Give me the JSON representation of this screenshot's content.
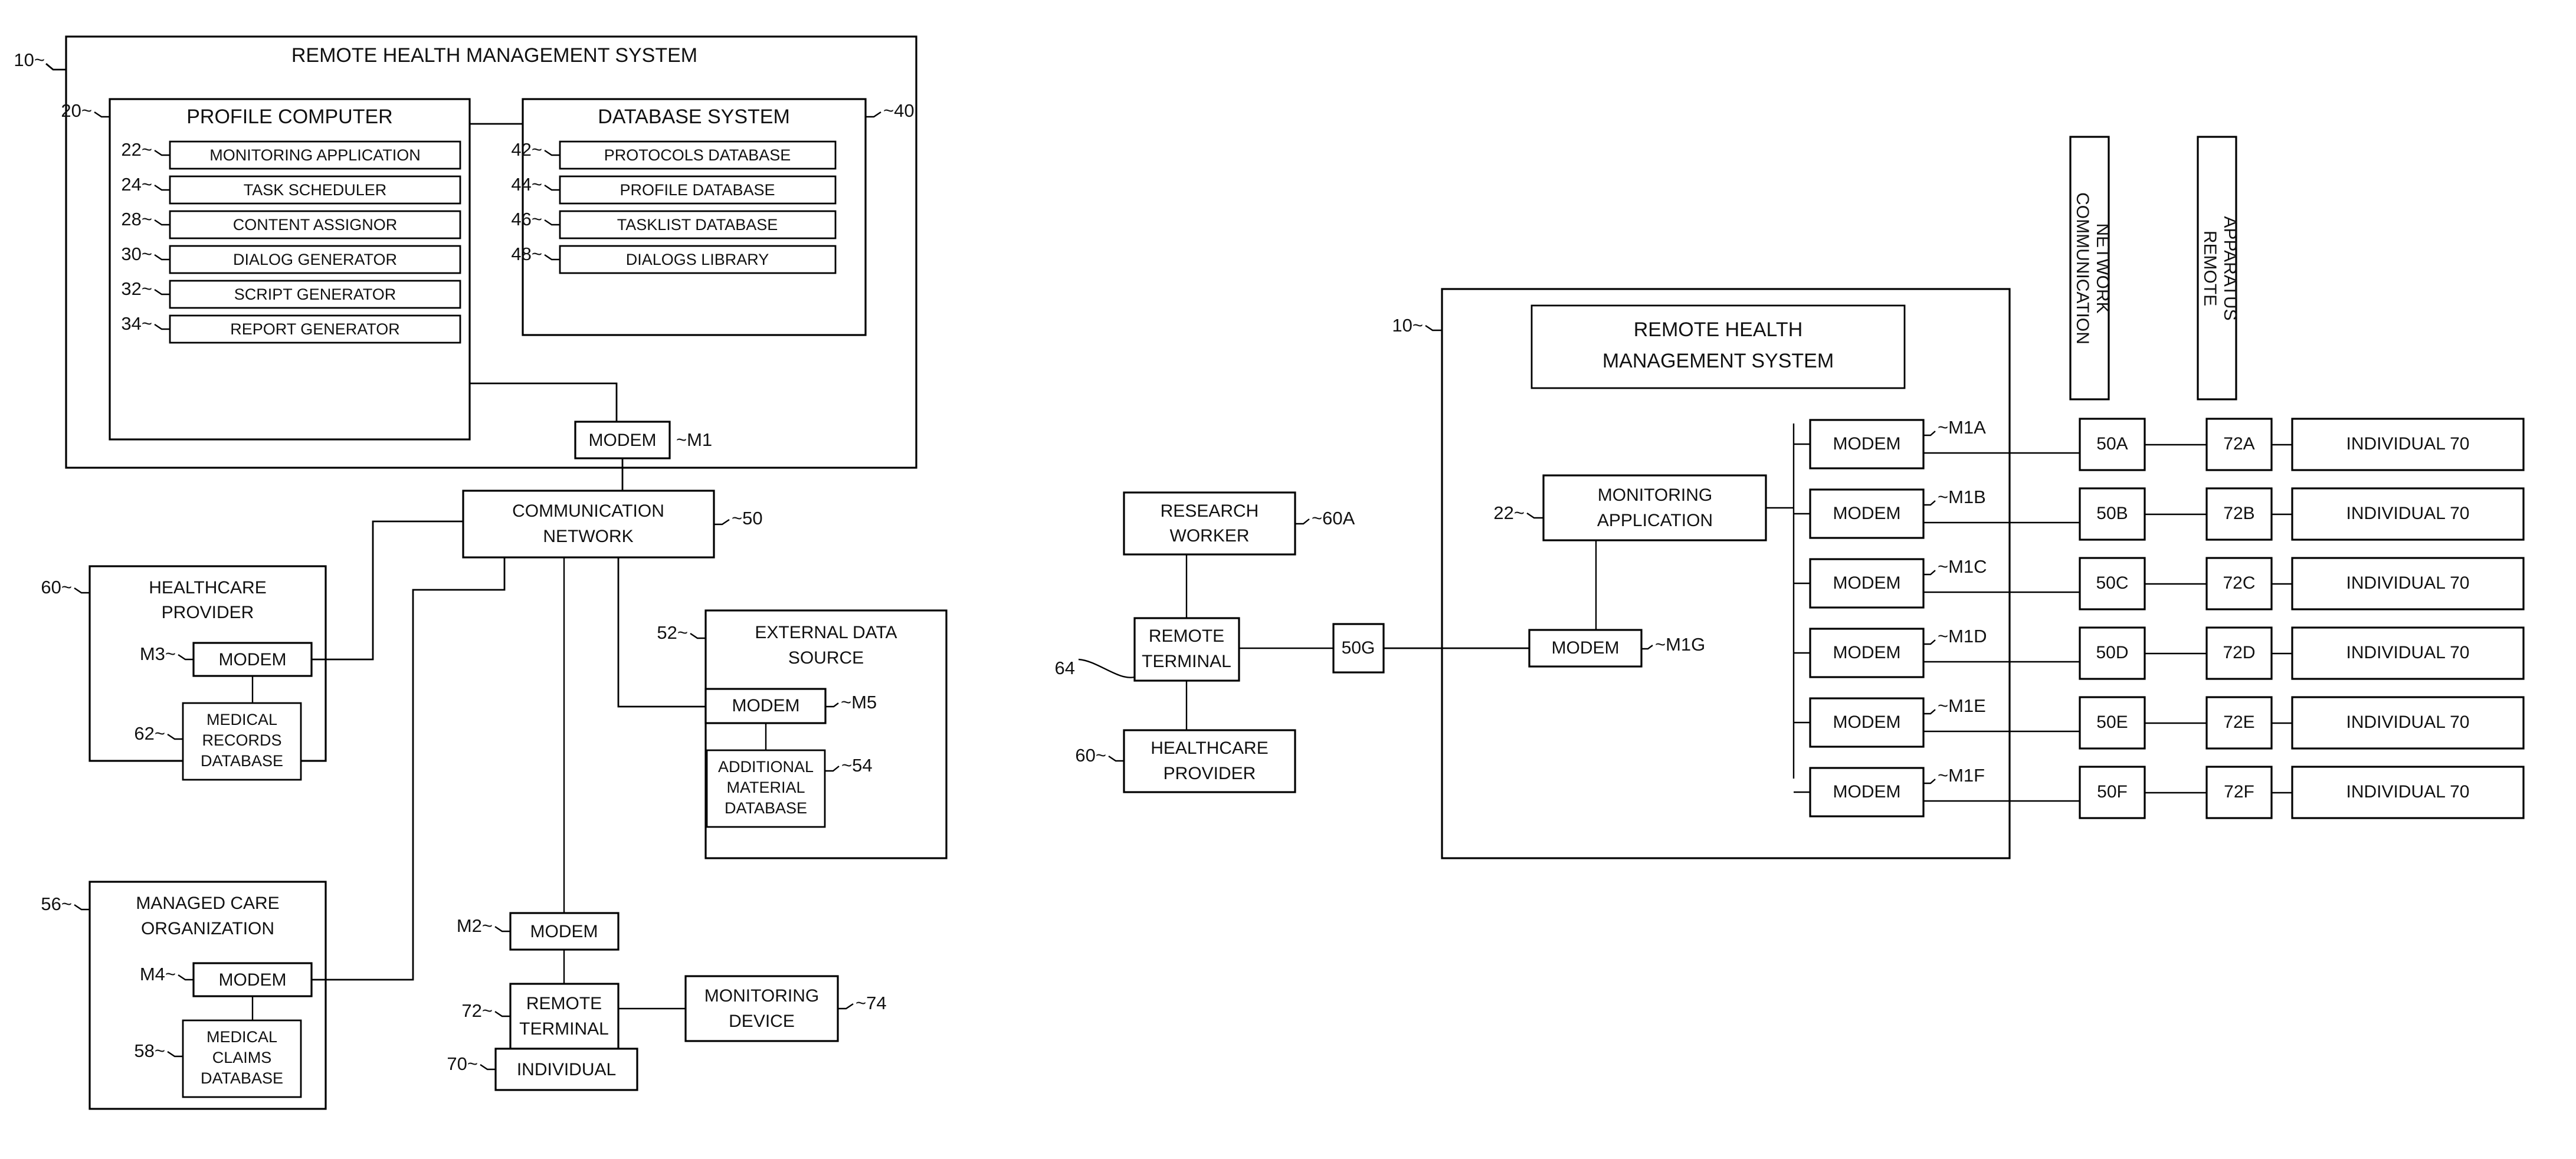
{
  "figure1": {
    "system": {
      "ref": "10~",
      "title": "REMOTE HEALTH MANAGEMENT SYSTEM"
    },
    "profile_computer": {
      "ref": "20~",
      "title": "PROFILE COMPUTER",
      "items": [
        {
          "ref": "22~",
          "label": "MONITORING APPLICATION"
        },
        {
          "ref": "24~",
          "label": "TASK SCHEDULER"
        },
        {
          "ref": "28~",
          "label": "CONTENT ASSIGNOR"
        },
        {
          "ref": "30~",
          "label": "DIALOG GENERATOR"
        },
        {
          "ref": "32~",
          "label": "SCRIPT GENERATOR"
        },
        {
          "ref": "34~",
          "label": "REPORT GENERATOR"
        }
      ]
    },
    "database_system": {
      "ref": "~40",
      "title": "DATABASE SYSTEM",
      "items": [
        {
          "ref": "42~",
          "label": "PROTOCOLS DATABASE"
        },
        {
          "ref": "44~",
          "label": "PROFILE DATABASE"
        },
        {
          "ref": "46~",
          "label": "TASKLIST DATABASE"
        },
        {
          "ref": "48~",
          "label": "DIALOGS LIBRARY"
        }
      ]
    },
    "modem_m1": {
      "label": "MODEM",
      "ref": "~M1"
    },
    "communication_network": {
      "ref": "~50",
      "line1": "COMMUNICATION",
      "line2": "NETWORK"
    },
    "healthcare_provider": {
      "ref": "60~",
      "line1": "HEALTHCARE",
      "line2": "PROVIDER",
      "modem": {
        "ref": "M3~",
        "label": "MODEM"
      },
      "database": {
        "ref": "62~",
        "line1": "MEDICAL",
        "line2": "RECORDS",
        "line3": "DATABASE"
      }
    },
    "external_data_source": {
      "ref": "52~",
      "line1": "EXTERNAL DATA",
      "line2": "SOURCE",
      "modem": {
        "label": "MODEM",
        "ref": "~M5"
      },
      "database": {
        "ref": "~54",
        "line1": "ADDITIONAL",
        "line2": "MATERIAL",
        "line3": "DATABASE"
      }
    },
    "managed_care_organization": {
      "ref": "56~",
      "line1": "MANAGED CARE",
      "line2": "ORGANIZATION",
      "modem": {
        "ref": "M4~",
        "label": "MODEM"
      },
      "database": {
        "ref": "58~",
        "line1": "MEDICAL",
        "line2": "CLAIMS",
        "line3": "DATABASE"
      }
    },
    "modem_m2": {
      "ref": "M2~",
      "label": "MODEM"
    },
    "remote_terminal": {
      "ref": "72~",
      "line1": "REMOTE",
      "line2": "TERMINAL"
    },
    "individual": {
      "ref": "70~",
      "label": "INDIVIDUAL"
    },
    "monitoring_device": {
      "ref": "~74",
      "line1": "MONITORING",
      "line2": "DEVICE"
    }
  },
  "figure2": {
    "column_headers": [
      {
        "line1": "COMMUNICATION",
        "line2": "NETWORK"
      },
      {
        "line1": "REMOTE",
        "line2": "APPARATUS"
      }
    ],
    "system": {
      "ref": "10~",
      "line1": "REMOTE HEALTH",
      "line2": "MANAGEMENT SYSTEM"
    },
    "monitoring_application": {
      "ref": "22~",
      "line1": "MONITORING",
      "line2": "APPLICATION"
    },
    "modem_m1g": {
      "label": "MODEM",
      "ref": "~M1G"
    },
    "gateway_50g": {
      "label": "50G"
    },
    "research_worker": {
      "ref": "~60A",
      "line1": "RESEARCH",
      "line2": "WORKER"
    },
    "remote_terminal": {
      "ref": "64",
      "line1": "REMOTE",
      "line2": "TERMINAL"
    },
    "healthcare_provider": {
      "ref": "60~",
      "line1": "HEALTHCARE",
      "line2": "PROVIDER"
    },
    "rows": [
      {
        "modem": "MODEM",
        "modem_ref": "~M1A",
        "network": "50A",
        "terminal": "72A",
        "individual": "INDIVIDUAL 70"
      },
      {
        "modem": "MODEM",
        "modem_ref": "~M1B",
        "network": "50B",
        "terminal": "72B",
        "individual": "INDIVIDUAL 70"
      },
      {
        "modem": "MODEM",
        "modem_ref": "~M1C",
        "network": "50C",
        "terminal": "72C",
        "individual": "INDIVIDUAL 70"
      },
      {
        "modem": "MODEM",
        "modem_ref": "~M1D",
        "network": "50D",
        "terminal": "72D",
        "individual": "INDIVIDUAL 70"
      },
      {
        "modem": "MODEM",
        "modem_ref": "~M1E",
        "network": "50E",
        "terminal": "72E",
        "individual": "INDIVIDUAL 70"
      },
      {
        "modem": "MODEM",
        "modem_ref": "~M1F",
        "network": "50F",
        "terminal": "72F",
        "individual": "INDIVIDUAL 70"
      }
    ]
  },
  "colors": {
    "ink": "#111111",
    "paper": "#ffffff"
  }
}
